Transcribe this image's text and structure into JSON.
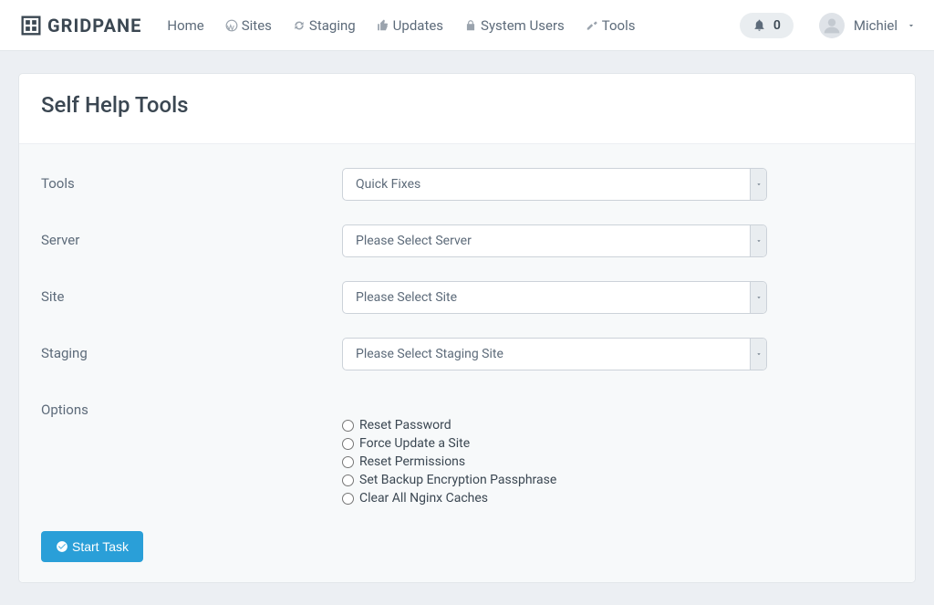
{
  "brand": "GRIDPANE",
  "nav": {
    "home": "Home",
    "sites": "Sites",
    "staging": "Staging",
    "updates": "Updates",
    "system_users": "System Users",
    "tools": "Tools"
  },
  "notifications_count": "0",
  "user_name": "Michiel",
  "page_title": "Self Help Tools",
  "labels": {
    "tools": "Tools",
    "server": "Server",
    "site": "Site",
    "staging": "Staging",
    "options": "Options"
  },
  "selects": {
    "tools": "Quick Fixes",
    "server": "Please Select Server",
    "site": "Please Select Site",
    "staging": "Please Select Staging Site"
  },
  "options": [
    "Reset Password",
    "Force Update a Site",
    "Reset Permissions",
    "Set Backup Encryption Passphrase",
    "Clear All Nginx Caches"
  ],
  "start_task": "Start Task"
}
